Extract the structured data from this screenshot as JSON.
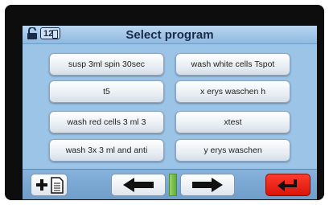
{
  "title": "Select program",
  "counter": "12",
  "programs": [
    "susp 3ml spin 30sec",
    "wash white cells Tspot",
    "t5",
    "x erys waschen h",
    "wash  red cells 3 ml 3",
    "xtest",
    "wash 3x 3 ml and anti",
    "y erys waschen"
  ],
  "colors": {
    "screen_bg": "#9cc4e6",
    "button_bg": "#ffffff",
    "return_button": "#e31d12",
    "indicator": "#6fbf45"
  },
  "icons": {
    "lock": "padlock-open",
    "add": "plus-document",
    "left": "arrow-left",
    "right": "arrow-right",
    "return": "return-arrow"
  }
}
